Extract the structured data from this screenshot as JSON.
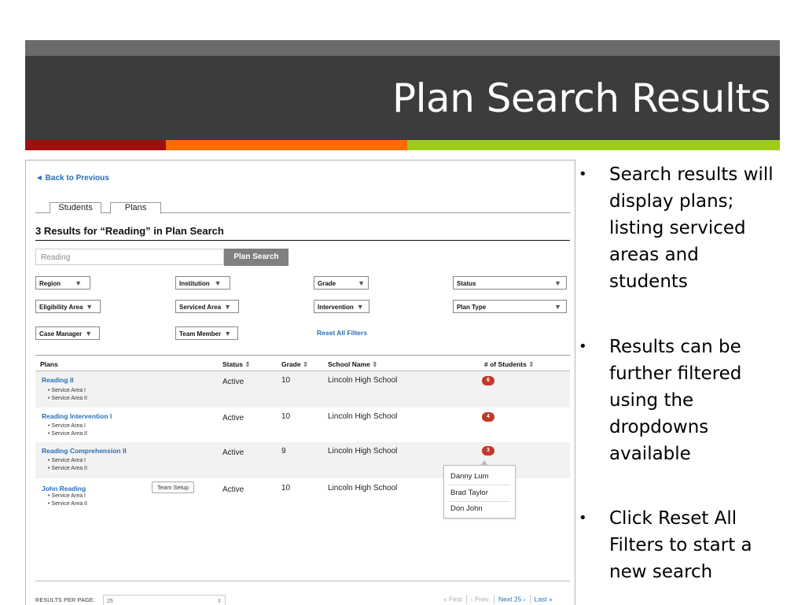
{
  "slide": {
    "title": "Plan Search Results",
    "accent_colors": [
      "#9e0f10",
      "#ff6a00",
      "#9ccb19"
    ]
  },
  "app": {
    "back_link": "◄ Back  to Previous",
    "tabs": [
      "Students",
      "Plans"
    ],
    "active_tab": "Plans",
    "results_heading": "3 Results for “Reading” in Plan Search",
    "search": {
      "value": "Reading",
      "button": "Plan Search"
    },
    "filters": {
      "region": "Region",
      "institution": "Institution",
      "grade": "Grade",
      "status": "Status",
      "eligibility_area": "Eligibility Area",
      "serviced_area": "Serviced Area",
      "intervention": "Intervention",
      "plan_type": "Plan Type",
      "case_manager": "Case Manager",
      "team_member": "Team Member",
      "reset": "Reset All Filters"
    },
    "columns": [
      "Plans",
      "Status",
      "Grade",
      "School Name",
      "# of Students"
    ],
    "rows": [
      {
        "plan": "Reading II",
        "areas": [
          "• Service Area I",
          "• Service Area II"
        ],
        "status": "Active",
        "grade": "10",
        "school": "Lincoln High School",
        "students": "6"
      },
      {
        "plan": "Reading Intervention I",
        "areas": [
          "• Service Area I",
          "• Service Area II"
        ],
        "status": "Active",
        "grade": "10",
        "school": "Lincoln High School",
        "students": "4"
      },
      {
        "plan": "Reading Comprehension II",
        "areas": [
          "• Service Area I",
          "• Service Area II"
        ],
        "status": "Active",
        "grade": "9",
        "school": "Lincoln High School",
        "students": "3"
      },
      {
        "plan": "John Reading",
        "areas": [
          "• Service Area I",
          "• Service Area II"
        ],
        "status": "Active",
        "grade": "10",
        "school": "Lincoln High School",
        "team_button": "Team Setup"
      }
    ],
    "student_popup": [
      "Danny Lum",
      "Brad Taylor",
      "Don John"
    ],
    "results_per_page_label": "RESULTS PER PAGE:",
    "results_per_page_value": "25",
    "pager": {
      "first": "« First",
      "prev": "‹ Prev.",
      "next": "Next 25 ›",
      "last": "Last »"
    }
  },
  "bullets": [
    "Search results will display plans; listing serviced areas and students",
    "Results can be further filtered using the dropdowns available",
    "Click Reset All Filters to start a new search"
  ]
}
